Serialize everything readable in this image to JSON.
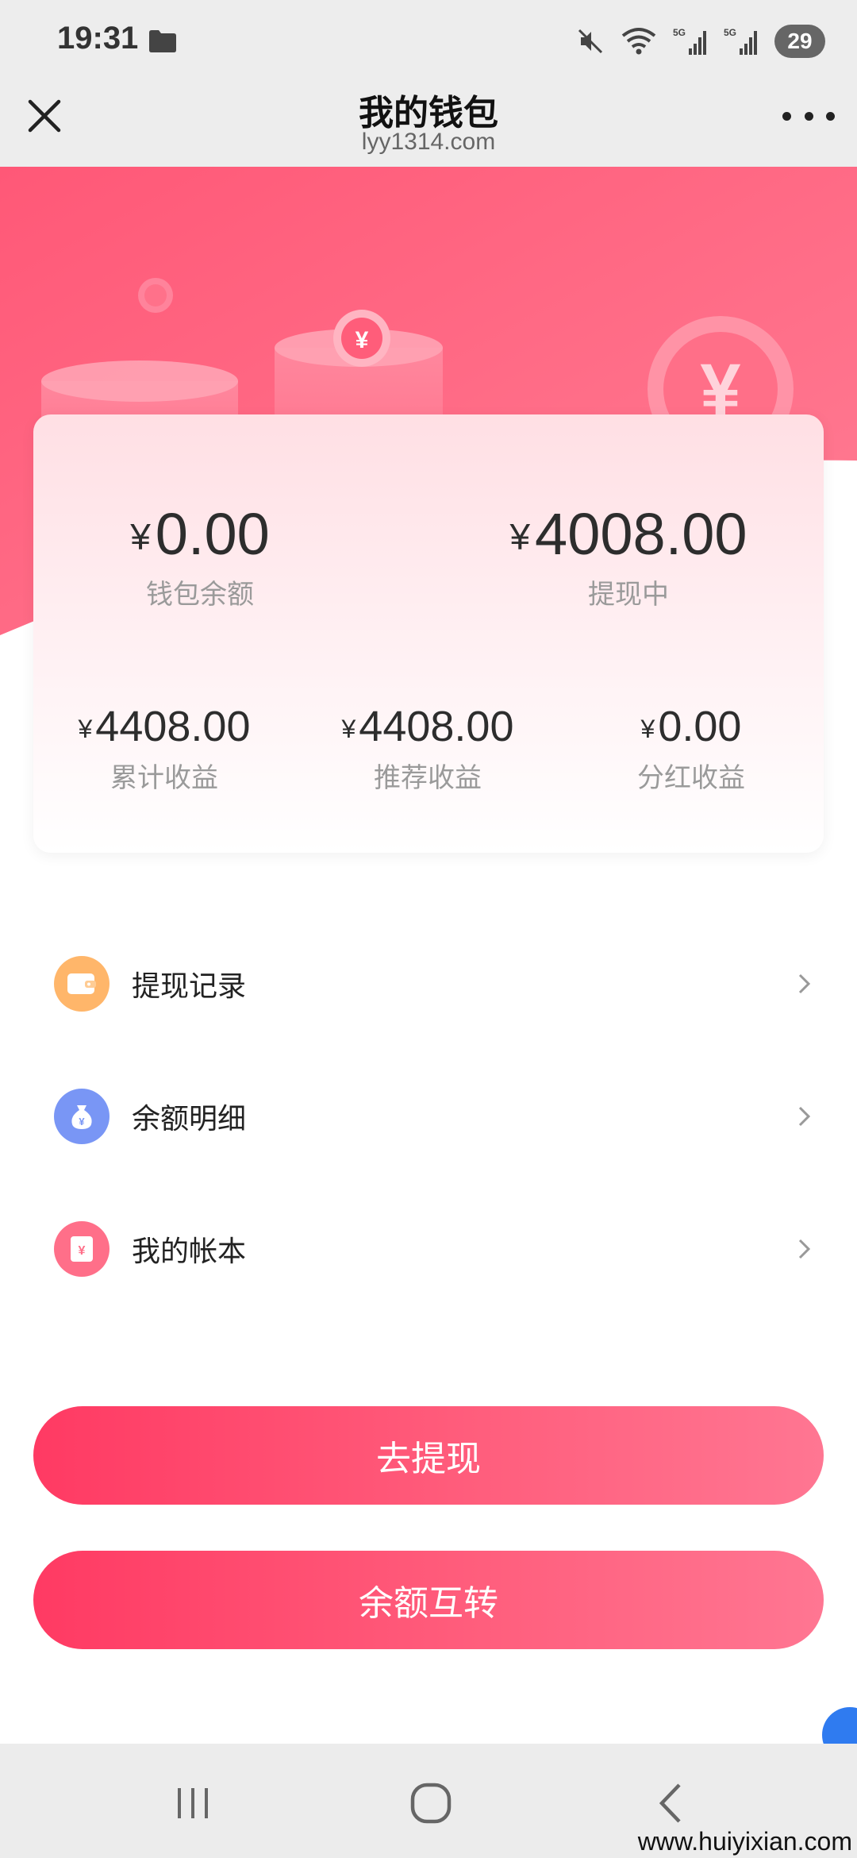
{
  "status_bar": {
    "time": "19:31",
    "battery": "29",
    "icons": [
      "folder-icon",
      "mute-icon",
      "wifi-icon",
      "signal-5g-icon",
      "signal-5g-icon",
      "battery-icon"
    ]
  },
  "title_bar": {
    "title": "我的钱包",
    "subtitle": "lyy1314.com"
  },
  "wallet": {
    "currency": "¥",
    "balance": {
      "value": "0.00",
      "label": "钱包余额"
    },
    "withdrawing": {
      "value": "4008.00",
      "label": "提现中"
    },
    "total_income": {
      "value": "4408.00",
      "label": "累计收益"
    },
    "referral_income": {
      "value": "4408.00",
      "label": "推荐收益"
    },
    "dividend_income": {
      "value": "0.00",
      "label": "分红收益"
    }
  },
  "menu": [
    {
      "label": "提现记录",
      "icon": "wallet-icon",
      "color": "#ffae5c"
    },
    {
      "label": "余额明细",
      "icon": "money-bag-icon",
      "color": "#6f8ff5"
    },
    {
      "label": "我的帐本",
      "icon": "ledger-icon",
      "color": "#ff6c87"
    }
  ],
  "buttons": {
    "withdraw": "去提现",
    "transfer": "余额互转"
  },
  "colors": {
    "accent": "#ff4468",
    "hero_start": "#ff5a78",
    "hero_end": "#ff7a92"
  },
  "watermark": "www.huiyixian.com"
}
